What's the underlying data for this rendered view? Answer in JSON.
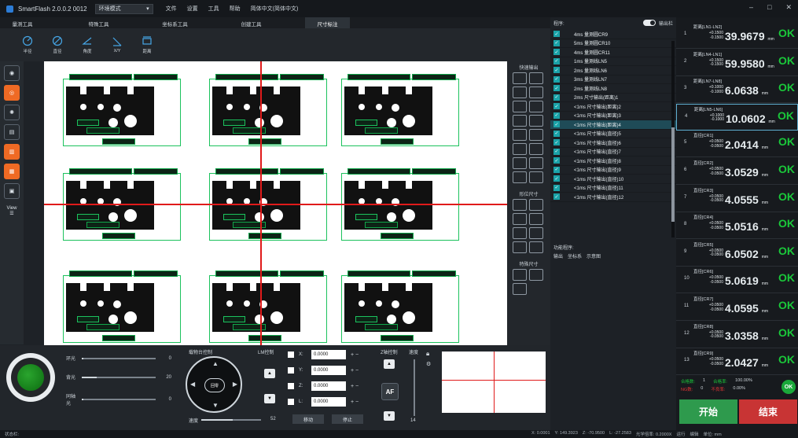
{
  "titlebar": {
    "app_title": "SmartFlash 2.0.0.2 0012",
    "mode": "环境模式",
    "menu": [
      "文件",
      "设置",
      "工具",
      "帮助",
      "简体中文(简体中文)"
    ],
    "win_min": "–",
    "win_max": "□",
    "win_close": "✕"
  },
  "tooltabs": [
    "量测工具",
    "特殊工具",
    "坐标系工具",
    "创建工具",
    "尺寸标注"
  ],
  "toolicons": [
    "半径",
    "直径",
    "角度",
    "X/Y",
    "距离"
  ],
  "leftcol": {
    "view_label": "View"
  },
  "rtools": {
    "quick_output": "快速输出",
    "shape_size": "形位尺寸",
    "special_size": "特殊尺寸"
  },
  "bottom": {
    "lights": [
      {
        "label": "环光",
        "value": "0",
        "level": 0.02
      },
      {
        "label": "背光",
        "value": "20",
        "level": 0.2
      },
      {
        "label": "同轴光",
        "value": "0",
        "level": 0.02
      }
    ],
    "nav_label": "载物台控制",
    "lm_label": "LM控制",
    "z_label": "Z轴控制",
    "speed_label": "速度",
    "speed_value": "52",
    "speed_level": 0.52,
    "z_value": "14",
    "center_btn": "回零",
    "axes": [
      {
        "label": "X:",
        "value": "0.0000"
      },
      {
        "label": "Y:",
        "value": "0.0000"
      },
      {
        "label": "Z:",
        "value": "0.0000"
      },
      {
        "label": "L:",
        "value": "0.0000"
      }
    ],
    "move_btn": "移动",
    "stop_btn": "停止",
    "af_btn": "AF"
  },
  "program": {
    "title": "程序:",
    "output_label": "输出栏",
    "rows": [
      {
        "text": "4ms 量测圆CR9"
      },
      {
        "text": "5ms 量测圆CR10"
      },
      {
        "text": "4ms 量测圆CR11"
      },
      {
        "text": "1ms 量测线LN5"
      },
      {
        "text": "2ms 量测线LN6"
      },
      {
        "text": "3ms 量测线LN7"
      },
      {
        "text": "2ms 量测线LN8"
      },
      {
        "text": "2ms 尺寸输出(距离)1"
      },
      {
        "text": "<1ms 尺寸输出(距离)2"
      },
      {
        "text": "<1ms 尺寸输出(距离)3"
      },
      {
        "text": "<1ms 尺寸输出(距离)4"
      },
      {
        "text": "<1ms 尺寸输出(直径)5"
      },
      {
        "text": "<1ms 尺寸输出(直径)6"
      },
      {
        "text": "<1ms 尺寸输出(直径)7"
      },
      {
        "text": "<1ms 尺寸输出(直径)8"
      },
      {
        "text": "<1ms 尺寸输出(直径)9"
      },
      {
        "text": "<1ms 尺寸输出(直径)10"
      },
      {
        "text": "<1ms 尺寸输出(直径)11"
      },
      {
        "text": "<1ms 尺寸输出(直径)12"
      }
    ],
    "selected_index": 10,
    "fn_title": "功能程序:",
    "fn_tabs": [
      "输出",
      "坐标系",
      "示意图"
    ],
    "coords": [
      "X: 0.0001",
      "Y: 149.3923",
      "Z: -70.9500",
      "L: -27.2583",
      "光学倍率: 0.2000X",
      "运行",
      "编辑",
      "单位: mm"
    ]
  },
  "results": {
    "rows": [
      {
        "idx": "1",
        "name": "距离[LN1-LN2]",
        "tol_hi": "+0.1500",
        "tol_lo": "-0.1500",
        "value": "39.9679",
        "unit": "mm",
        "status": "OK"
      },
      {
        "idx": "2",
        "name": "距离[LN4-LN1]",
        "tol_hi": "+0.1500",
        "tol_lo": "-0.1500",
        "value": "59.9580",
        "unit": "mm",
        "status": "OK"
      },
      {
        "idx": "3",
        "name": "距离[LN7-LN8]",
        "tol_hi": "+0.1000",
        "tol_lo": "-0.1000",
        "value": "6.0638",
        "unit": "mm",
        "status": "OK"
      },
      {
        "idx": "4",
        "name": "距离[LN5-LN6]",
        "tol_hi": "+0.1000",
        "tol_lo": "-0.1000",
        "value": "10.0602",
        "unit": "mm",
        "status": "OK"
      },
      {
        "idx": "5",
        "name": "直径[CR1]",
        "tol_hi": "+0.0500",
        "tol_lo": "-0.0500",
        "value": "2.0414",
        "unit": "mm",
        "status": "OK"
      },
      {
        "idx": "6",
        "name": "直径[CR2]",
        "tol_hi": "+0.0500",
        "tol_lo": "-0.0500",
        "value": "3.0529",
        "unit": "mm",
        "status": "OK"
      },
      {
        "idx": "7",
        "name": "直径[CR3]",
        "tol_hi": "+0.0500",
        "tol_lo": "-0.0500",
        "value": "4.0555",
        "unit": "mm",
        "status": "OK"
      },
      {
        "idx": "8",
        "name": "直径[CR4]",
        "tol_hi": "+0.0500",
        "tol_lo": "-0.0500",
        "value": "5.0516",
        "unit": "mm",
        "status": "OK"
      },
      {
        "idx": "9",
        "name": "直径[CR5]",
        "tol_hi": "+0.0500",
        "tol_lo": "-0.0500",
        "value": "6.0502",
        "unit": "mm",
        "status": "OK"
      },
      {
        "idx": "10",
        "name": "直径[CR6]",
        "tol_hi": "+0.0500",
        "tol_lo": "-0.0500",
        "value": "5.0619",
        "unit": "mm",
        "status": "OK"
      },
      {
        "idx": "11",
        "name": "直径[CR7]",
        "tol_hi": "+0.0500",
        "tol_lo": "-0.0500",
        "value": "4.0595",
        "unit": "mm",
        "status": "OK"
      },
      {
        "idx": "12",
        "name": "直径[CR8]",
        "tol_hi": "+0.0500",
        "tol_lo": "-0.0500",
        "value": "3.0358",
        "unit": "mm",
        "status": "OK"
      },
      {
        "idx": "13",
        "name": "直径[CR9]",
        "tol_hi": "+0.0500",
        "tol_lo": "-0.0500",
        "value": "2.0427",
        "unit": "mm",
        "status": "OK"
      }
    ],
    "selected_index": 3,
    "summary": [
      {
        "label": "合格数:",
        "count": "1",
        "rate_label": "合格率:",
        "rate": "100.00%"
      },
      {
        "label": "NG数:",
        "count": "0",
        "rate_label": "不良率:",
        "rate": "0.00%"
      }
    ],
    "ok_badge": "OK",
    "start_btn": "开始",
    "end_btn": "结束"
  },
  "statusbar": {
    "text": "状态栏:"
  },
  "colors": {
    "ok": "#1ac83a",
    "ng": "#e03434",
    "accent": "#ef6a24",
    "crosshair": "#e01a1a"
  }
}
